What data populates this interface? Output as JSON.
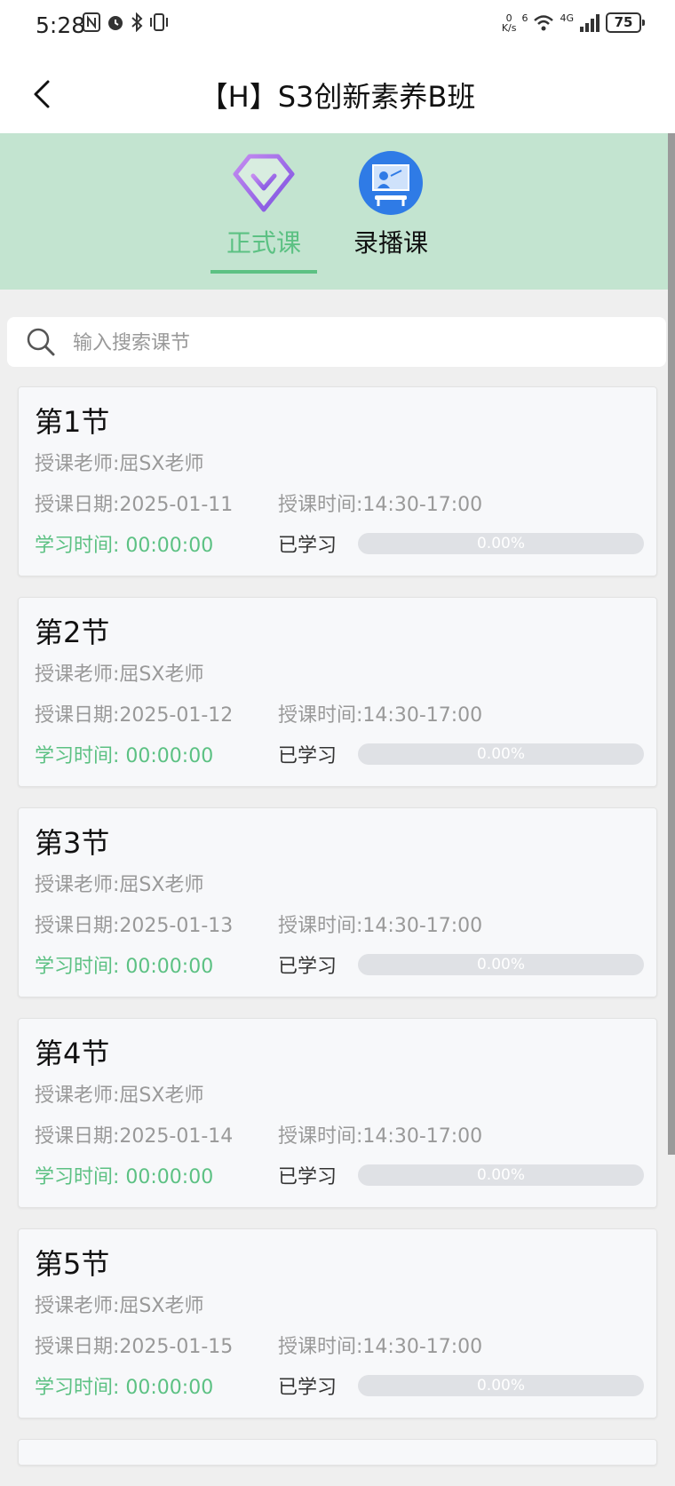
{
  "status_bar": {
    "time": "5:28",
    "net_speed_value": "0",
    "net_speed_unit": "K/s",
    "signal_label": "4G",
    "wifi_label": "6",
    "battery": "75"
  },
  "header": {
    "title": "【H】S3创新素养B班"
  },
  "tabs": {
    "formal_label": "正式课",
    "record_label": "录播课"
  },
  "search": {
    "placeholder": "输入搜索课节"
  },
  "lessons": [
    {
      "title": "第1节",
      "teacher": "授课老师:屈SX老师",
      "date": "授课日期:2025-01-11",
      "time": "授课时间:14:30-17:00",
      "study": "学习时间: 00:00:00",
      "learned": "已学习",
      "progress_label": "0.00%",
      "progress": 0
    },
    {
      "title": "第2节",
      "teacher": "授课老师:屈SX老师",
      "date": "授课日期:2025-01-12",
      "time": "授课时间:14:30-17:00",
      "study": "学习时间: 00:00:00",
      "learned": "已学习",
      "progress_label": "0.00%",
      "progress": 0
    },
    {
      "title": "第3节",
      "teacher": "授课老师:屈SX老师",
      "date": "授课日期:2025-01-13",
      "time": "授课时间:14:30-17:00",
      "study": "学习时间: 00:00:00",
      "learned": "已学习",
      "progress_label": "0.00%",
      "progress": 0
    },
    {
      "title": "第4节",
      "teacher": "授课老师:屈SX老师",
      "date": "授课日期:2025-01-14",
      "time": "授课时间:14:30-17:00",
      "study": "学习时间: 00:00:00",
      "learned": "已学习",
      "progress_label": "0.00%",
      "progress": 0
    },
    {
      "title": "第5节",
      "teacher": "授课老师:屈SX老师",
      "date": "授课日期:2025-01-15",
      "time": "授课时间:14:30-17:00",
      "study": "学习时间: 00:00:00",
      "learned": "已学习",
      "progress_label": "0.00%",
      "progress": 0
    }
  ],
  "colors": {
    "accent": "#5cc183",
    "tab_bar_bg": "#c3e4d0",
    "formal_icon": "#a56ee8",
    "record_icon": "#2f7be6"
  },
  "icons": {
    "back": "chevron-left-icon",
    "formal": "diamond-icon",
    "record": "teacher-board-icon",
    "search": "search-icon"
  }
}
